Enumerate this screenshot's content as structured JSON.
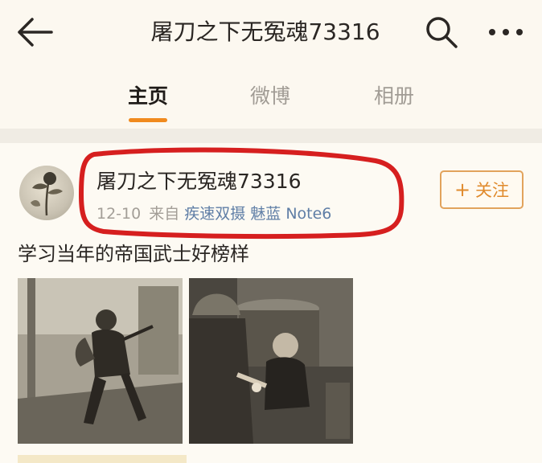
{
  "header": {
    "title": "屠刀之下无冤魂73316",
    "icons": {
      "back": "back-arrow-icon",
      "search": "search-icon",
      "more": "more-icon"
    }
  },
  "tabs": [
    {
      "label": "主页",
      "active": true
    },
    {
      "label": "微博",
      "active": false
    },
    {
      "label": "相册",
      "active": false
    }
  ],
  "post": {
    "username": "屠刀之下无冤魂73316",
    "time": "12-10",
    "from_label": "来自",
    "device": "疾速双摄 魅蓝 Note6",
    "follow_label": "关注",
    "text": "学习当年的帝国武士好榜样"
  },
  "colors": {
    "accent": "#f08a1e",
    "follow_border": "#e2a35c",
    "device_link": "#5f7ea6",
    "annotation_red": "#d61f1f"
  }
}
